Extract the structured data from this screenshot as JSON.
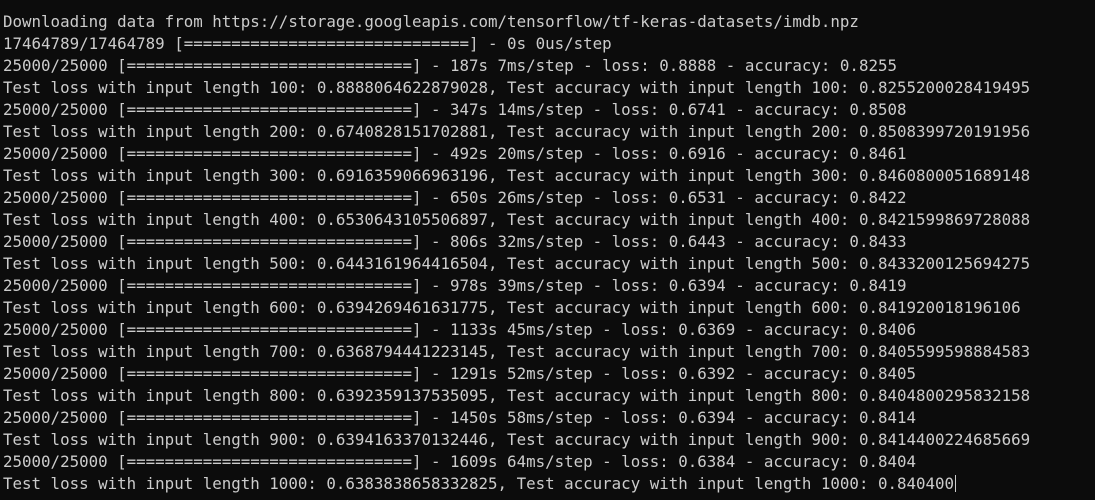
{
  "terminal": {
    "lines": [
      "Downloading data from https://storage.googleapis.com/tensorflow/tf-keras-datasets/imdb.npz",
      "17464789/17464789 [==============================] - 0s 0us/step",
      "25000/25000 [==============================] - 187s 7ms/step - loss: 0.8888 - accuracy: 0.8255",
      "Test loss with input length 100: 0.8888064622879028, Test accuracy with input length 100: 0.8255200028419495",
      "25000/25000 [==============================] - 347s 14ms/step - loss: 0.6741 - accuracy: 0.8508",
      "Test loss with input length 200: 0.6740828151702881, Test accuracy with input length 200: 0.8508399720191956",
      "25000/25000 [==============================] - 492s 20ms/step - loss: 0.6916 - accuracy: 0.8461",
      "Test loss with input length 300: 0.6916359066963196, Test accuracy with input length 300: 0.8460800051689148",
      "25000/25000 [==============================] - 650s 26ms/step - loss: 0.6531 - accuracy: 0.8422",
      "Test loss with input length 400: 0.6530643105506897, Test accuracy with input length 400: 0.8421599869728088",
      "25000/25000 [==============================] - 806s 32ms/step - loss: 0.6443 - accuracy: 0.8433",
      "Test loss with input length 500: 0.6443161964416504, Test accuracy with input length 500: 0.8433200125694275",
      "25000/25000 [==============================] - 978s 39ms/step - loss: 0.6394 - accuracy: 0.8419",
      "Test loss with input length 600: 0.6394269461631775, Test accuracy with input length 600: 0.841920018196106",
      "25000/25000 [==============================] - 1133s 45ms/step - loss: 0.6369 - accuracy: 0.8406",
      "Test loss with input length 700: 0.6368794441223145, Test accuracy with input length 700: 0.8405599598884583",
      "25000/25000 [==============================] - 1291s 52ms/step - loss: 0.6392 - accuracy: 0.8405",
      "Test loss with input length 800: 0.6392359137535095, Test accuracy with input length 800: 0.8404800295832158",
      "25000/25000 [==============================] - 1450s 58ms/step - loss: 0.6394 - accuracy: 0.8414",
      "Test loss with input length 900: 0.6394163370132446, Test accuracy with input length 900: 0.8414400224685669",
      "25000/25000 [==============================] - 1609s 64ms/step - loss: 0.6384 - accuracy: 0.8404",
      "Test loss with input length 1000: 0.6383838658332825, Test accuracy with input length 1000: 0.840400"
    ]
  },
  "colors": {
    "background": "#0c0c0c",
    "foreground": "#cccccc"
  }
}
